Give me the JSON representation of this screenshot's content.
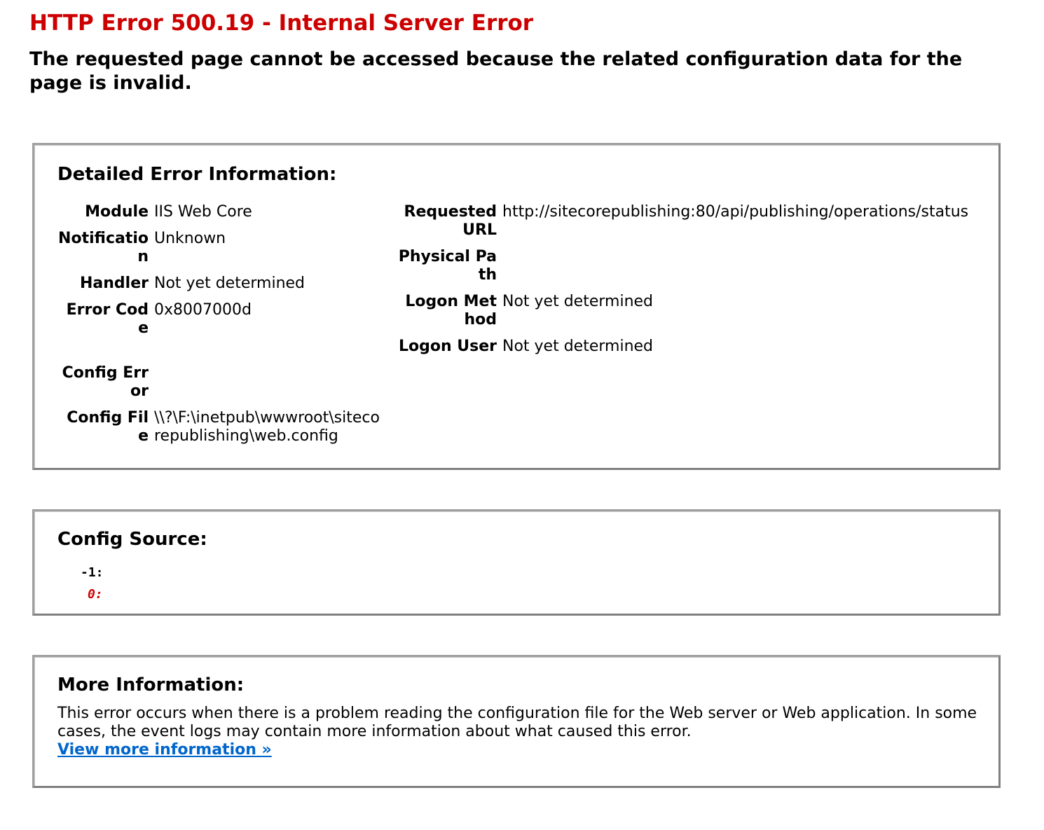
{
  "header": {
    "title": "HTTP Error 500.19 - Internal Server Error",
    "subtitle": "The requested page cannot be accessed because the related configuration data for the page is invalid."
  },
  "detail": {
    "heading": "Detailed Error Information:",
    "left": [
      {
        "label": "Module",
        "value": "IIS Web Core"
      },
      {
        "label": "Notification",
        "value": "Unknown"
      },
      {
        "label": "Handler",
        "value": "Not yet determined"
      },
      {
        "label": "Error Code",
        "value": "0x8007000d"
      },
      {
        "label": "Config Error",
        "value": ""
      },
      {
        "label": "Config File",
        "value": "\\\\?\\F:\\inetpub\\wwwroot\\sitecorepublishing\\web.config"
      }
    ],
    "right": [
      {
        "label": "Requested URL",
        "value": "http://sitecorepublishing:80/api/publishing/operations/status"
      },
      {
        "label": "Physical Path",
        "value": ""
      },
      {
        "label": "Logon Method",
        "value": "Not yet determined"
      },
      {
        "label": "Logon User",
        "value": "Not yet determined"
      }
    ]
  },
  "source": {
    "heading": "Config Source:",
    "lines": [
      {
        "num": "-1:",
        "error": false
      },
      {
        "num": "0:",
        "error": true
      }
    ]
  },
  "more": {
    "heading": "More Information:",
    "text": "This error occurs when there is a problem reading the configuration file for the Web server or Web application. In some cases, the event logs may contain more information about what caused this error.",
    "link_label": "View more information »"
  },
  "colors": {
    "error_red": "#cc0000",
    "link_blue": "#0066cc"
  }
}
